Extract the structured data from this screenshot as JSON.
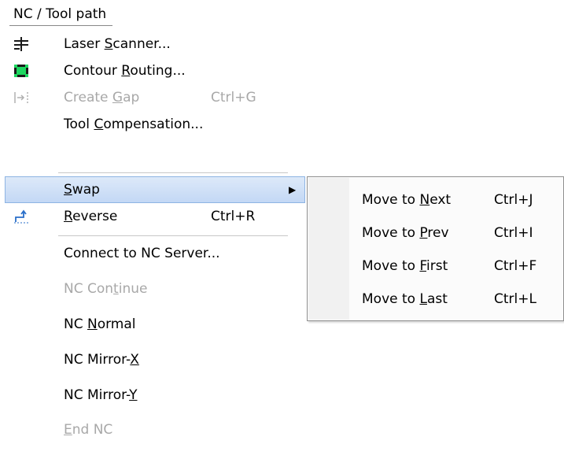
{
  "menubar": {
    "title": "NC / Tool path"
  },
  "menu": {
    "items": [
      {
        "label_pre": "Laser ",
        "label_ul": "S",
        "label_post": "canner...",
        "icon": "laser-scanner-icon"
      },
      {
        "label_pre": "Contour ",
        "label_ul": "R",
        "label_post": "outing...",
        "icon": "contour-routing-icon"
      },
      {
        "label_pre": "Create ",
        "label_ul": "G",
        "label_post": "ap",
        "shortcut": "Ctrl+G",
        "icon": "create-gap-icon",
        "disabled": true
      },
      {
        "label_pre": "Tool ",
        "label_ul": "C",
        "label_post": "ompensation..."
      },
      {
        "label_pre": "",
        "label_ul": "S",
        "label_post": "wap",
        "submenu": true
      },
      {
        "label_pre": "",
        "label_ul": "R",
        "label_post": "everse",
        "shortcut": "Ctrl+R",
        "icon": "reverse-icon"
      },
      {
        "label_pre": "Connect to NC Server...",
        "label_ul": "",
        "label_post": ""
      },
      {
        "label_pre": "NC Con",
        "label_ul": "t",
        "label_post": "inue",
        "disabled": true
      },
      {
        "label_pre": "NC ",
        "label_ul": "N",
        "label_post": "ormal"
      },
      {
        "label_pre": "NC Mirror-",
        "label_ul": "X",
        "label_post": ""
      },
      {
        "label_pre": "NC Mirror-",
        "label_ul": "Y",
        "label_post": ""
      },
      {
        "label_pre": "",
        "label_ul": "E",
        "label_post": "nd NC",
        "disabled": true
      }
    ]
  },
  "submenu": {
    "items": [
      {
        "label_pre": "Move to ",
        "label_ul": "N",
        "label_post": "ext",
        "shortcut": "Ctrl+J"
      },
      {
        "label_pre": "Move to ",
        "label_ul": "P",
        "label_post": "rev",
        "shortcut": "Ctrl+I"
      },
      {
        "label_pre": "Move to ",
        "label_ul": "F",
        "label_post": "irst",
        "shortcut": "Ctrl+F"
      },
      {
        "label_pre": "Move to ",
        "label_ul": "L",
        "label_post": "ast",
        "shortcut": "Ctrl+L"
      }
    ]
  },
  "colors": {
    "highlight": "#c3d8f5",
    "disabled_text": "#a8a8a8",
    "icon_green": "#1ed760"
  }
}
